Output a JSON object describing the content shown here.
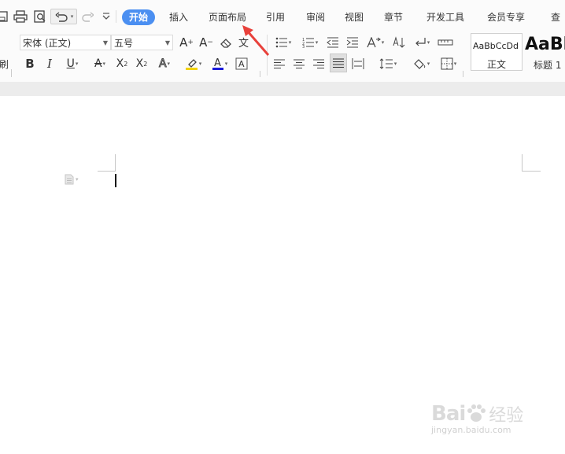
{
  "tabs": [
    "开始",
    "插入",
    "页面布局",
    "引用",
    "审阅",
    "视图",
    "章节",
    "开发工具",
    "会员专享"
  ],
  "tab_right_cut": "查",
  "active_tab": "开始",
  "font": {
    "name": "宋体 (正文)",
    "size": "五号"
  },
  "ribbon_left_cut": "刷",
  "styles": {
    "normal_preview": "AaBbCcDd",
    "normal_label": "正文",
    "heading_preview": "AaBl",
    "heading_label": "标题 1"
  },
  "watermark": {
    "brand": "Bai",
    "brand_cn": "经验",
    "url": "jingyan.baidu.com"
  },
  "colors": {
    "accent": "#4b8ff1",
    "arrow": "#e8413b",
    "font_color": "#1a1adb",
    "highlight": "#f2d200"
  }
}
